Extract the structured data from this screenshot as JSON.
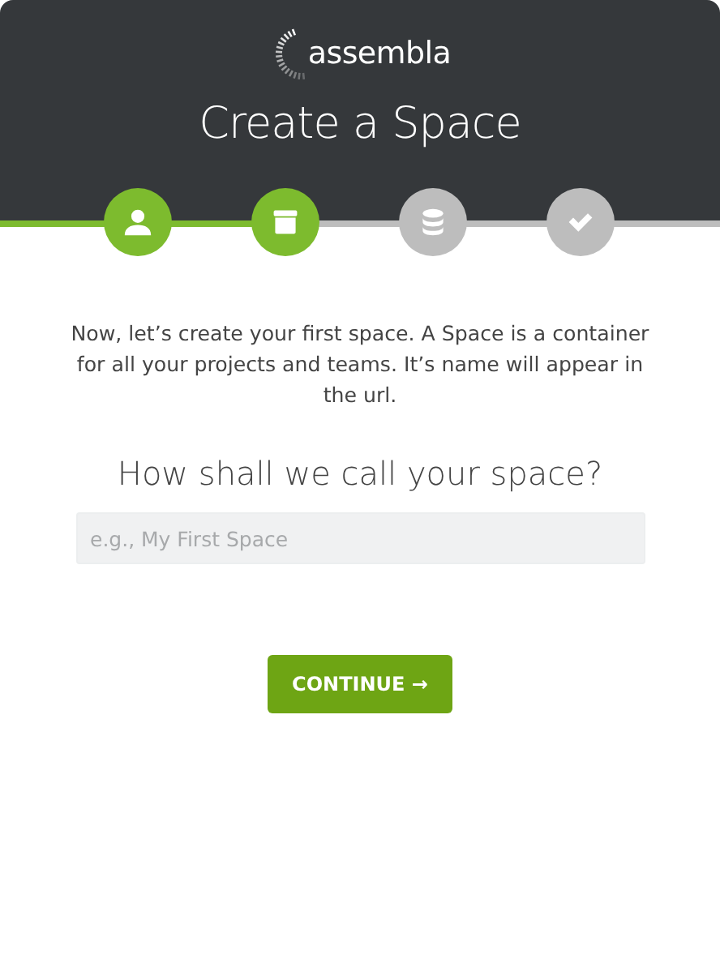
{
  "logo": {
    "text": "assembla"
  },
  "title": "Create a Space",
  "steps": [
    {
      "kind": "person",
      "done": true
    },
    {
      "kind": "box",
      "done": true
    },
    {
      "kind": "database",
      "done": false
    },
    {
      "kind": "check",
      "done": false
    }
  ],
  "intro": "Now, let’s create your first space. A Space is a container for all your projects and teams. It’s name will appear in the url.",
  "question": "How shall we call your space?",
  "name_field": {
    "placeholder": "e.g., My First Space"
  },
  "button": "CONTINUE →"
}
